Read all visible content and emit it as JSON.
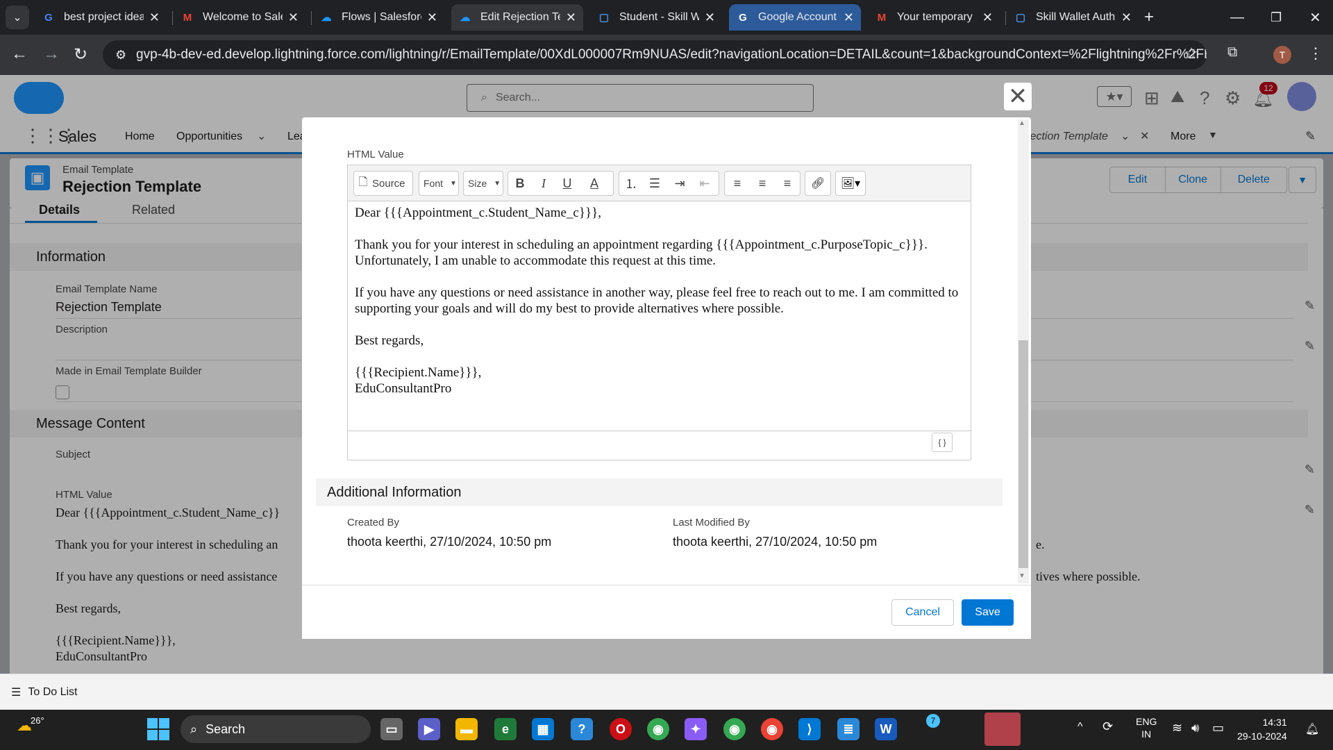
{
  "browser": {
    "tabs": [
      {
        "title": "best project idea",
        "icon": "google-icon"
      },
      {
        "title": "Welcome to Sale",
        "icon": "gmail-icon"
      },
      {
        "title": "Flows | Salesforce",
        "icon": "salesforce-cloud-icon"
      },
      {
        "title": "Edit Rejection Te",
        "icon": "salesforce-cloud-icon",
        "active": true
      },
      {
        "title": "Student - Skill W",
        "icon": "page-icon"
      },
      {
        "title": "Google Account",
        "icon": "google-icon"
      },
      {
        "title": "Your temporary",
        "icon": "gmail-icon"
      },
      {
        "title": "Skill Wallet Auth",
        "icon": "page-icon"
      }
    ],
    "url": "gvp-4b-dev-ed.develop.lightning.force.com/lightning/r/EmailTemplate/00XdL000007Rm9NUAS/edit?navigationLocation=DETAIL&count=1&backgroundContext=%2Flightning%2Fr%2FEmailTe...",
    "profile_initial": "T"
  },
  "sf": {
    "search_placeholder": "Search...",
    "app_name": "Sales",
    "nav": [
      "Home",
      "Opportunities",
      "Lea"
    ],
    "open_tab": "jection Template",
    "more": "More",
    "notif_count": "12",
    "object_type": "Email Template",
    "record_name": "Rejection Template",
    "actions": [
      "Edit",
      "Clone",
      "Delete"
    ],
    "subtabs": [
      "Details",
      "Related"
    ],
    "info_section": "Information",
    "fields": {
      "name_label": "Email Template Name",
      "name_value": "Rejection Template",
      "desc_label": "Description",
      "builder_label": "Made in Email Template Builder"
    },
    "msg_section": "Message Content",
    "subject_label": "Subject",
    "html_label": "HTML Value",
    "bg_lines": [
      "Dear {{{Appointment_c.Student_Name_c}}",
      "Thank you for your interest in scheduling an",
      "If you have any questions or need assistance",
      "Best regards,",
      "{{{Recipient.Name}}},",
      "EduConsultantPro"
    ],
    "bg_right": [
      "e.",
      "tives where possible."
    ],
    "todo": "To Do List"
  },
  "modal": {
    "html_label": "HTML Value",
    "toolbar": {
      "source": "Source",
      "font": "Font",
      "size": "Size",
      "bold": "B",
      "italic": "I",
      "underline": "U",
      "textcolor": "A",
      "merge": "{ }"
    },
    "body": [
      "Dear {{{Appointment_c.Student_Name_c}}},",
      "Thank you for your interest in scheduling an appointment regarding {{{Appointment_c.PurposeTopic_c}}}. Unfortunately, I am unable to accommodate this request at this time.",
      "If you have any questions or need assistance in another way, please feel free to reach out to me. I am committed to supporting your goals and will do my best to provide alternatives where possible.",
      "Best regards,",
      "{{{Recipient.Name}}},",
      "EduConsultantPro"
    ],
    "additional": "Additional Information",
    "created_label": "Created By",
    "created_value": "thoota keerthi, 27/10/2024, 10:50 pm",
    "modified_label": "Last Modified By",
    "modified_value": "thoota keerthi, 27/10/2024, 10:50 pm",
    "cancel": "Cancel",
    "save": "Save"
  },
  "taskbar": {
    "weather": "26°",
    "search": "Search",
    "lang1": "ENG",
    "lang2": "IN",
    "time": "14:31",
    "date": "29-10-2024",
    "badge": "7"
  }
}
